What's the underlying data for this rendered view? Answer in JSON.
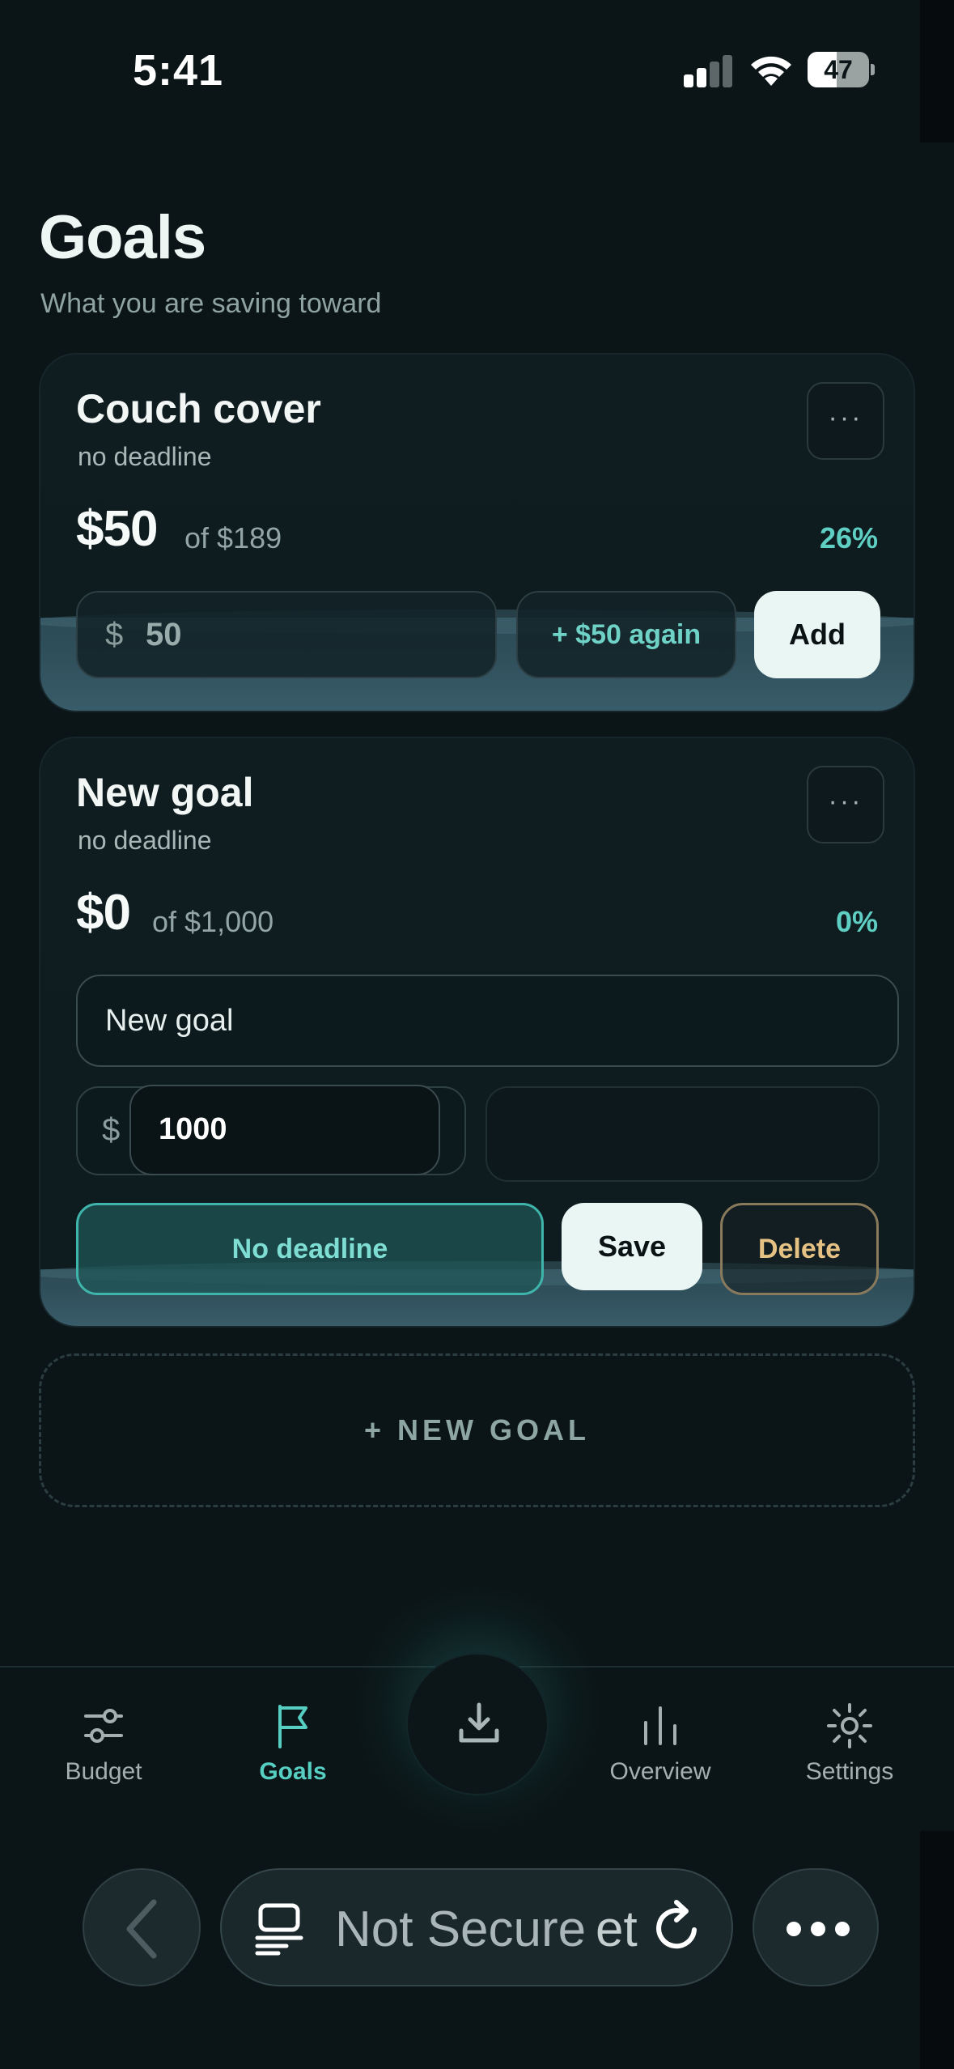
{
  "status_bar": {
    "time": "5:41",
    "battery": "47",
    "battery_fraction": 0.47
  },
  "header": {
    "title": "Goals",
    "subtitle": "What you are saving toward"
  },
  "goals": [
    {
      "name": "Couch cover",
      "deadline": "no deadline",
      "saved": "$50",
      "target": "of $189",
      "percent": "26%",
      "progress_fraction": 0.26,
      "currency_symbol": "$",
      "amount_value": "50",
      "repeat_label": "+ $50 again",
      "add_label": "Add",
      "more_label": "···"
    },
    {
      "name": "New goal",
      "deadline": "no deadline",
      "saved": "$0",
      "target": "of $1,000",
      "percent": "0%",
      "progress_fraction": 0.0,
      "more_label": "···",
      "edit": {
        "name_value": "New goal",
        "currency_symbol": "$",
        "target_value": "1000",
        "date_value": "",
        "no_deadline_label": "No deadline",
        "save_label": "Save",
        "delete_label": "Delete"
      }
    }
  ],
  "new_goal_label": "+ NEW GOAL",
  "tabs": [
    {
      "label": "Budget",
      "icon": "sliders-icon",
      "active": false
    },
    {
      "label": "Goals",
      "icon": "flag-icon",
      "active": true
    },
    {
      "label": "Overview",
      "icon": "bar-chart-icon",
      "active": false
    },
    {
      "label": "Settings",
      "icon": "gear-icon",
      "active": false
    }
  ],
  "fab": {
    "icon": "download-icon"
  },
  "browser": {
    "url_text": "Not Secure",
    "url_tail": "et"
  },
  "colors": {
    "accent": "#56cfc2",
    "background": "#0b1517",
    "delete": "#e6c184"
  }
}
